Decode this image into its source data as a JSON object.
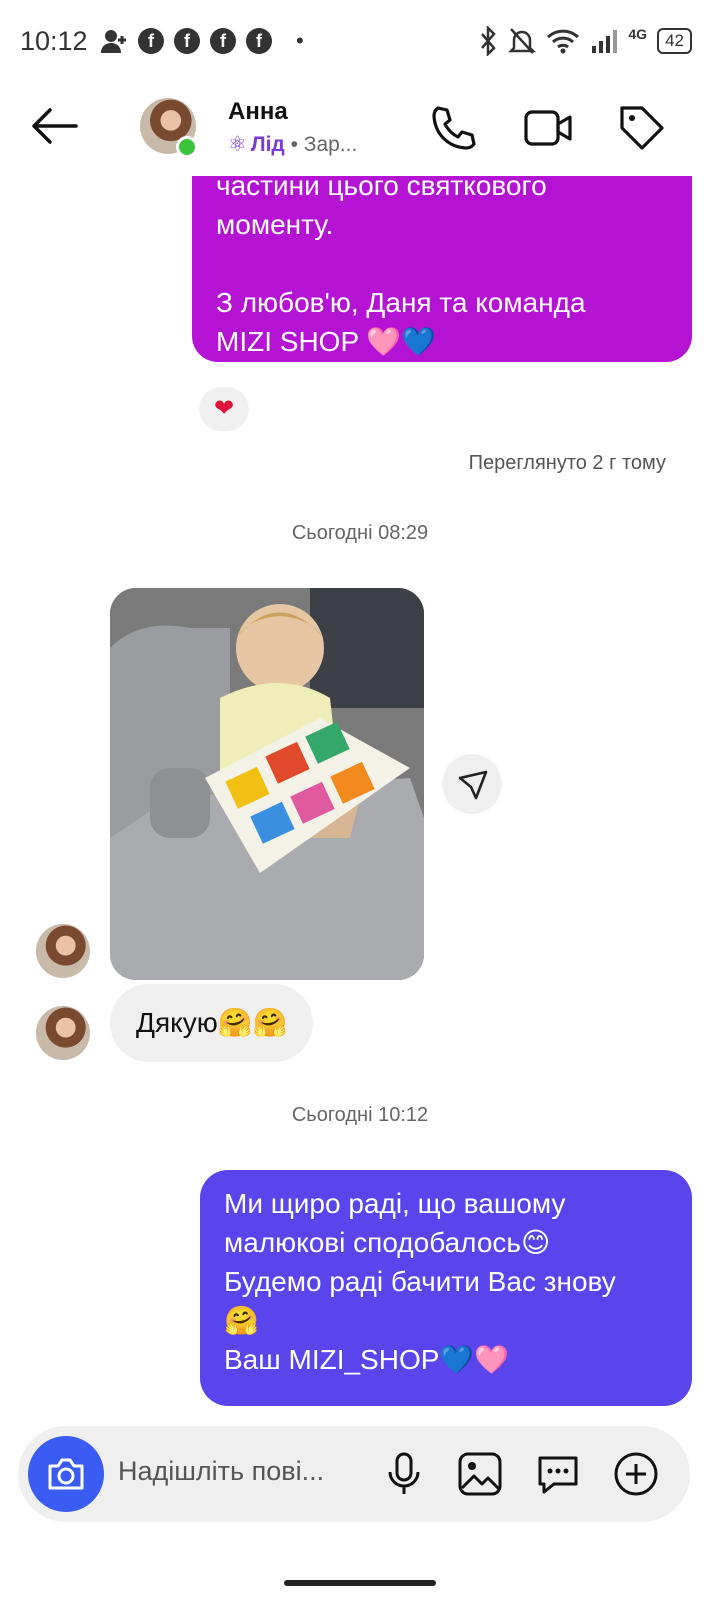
{
  "status_bar": {
    "time": "10:12",
    "network": "4G",
    "battery": "42"
  },
  "header": {
    "contact_name": "Анна",
    "lead_label": "Лід",
    "status_preview": "• Зар..."
  },
  "chat": {
    "messages": [
      {
        "type": "outgoing",
        "text": "частини цього святкового\nмоменту.\n\nЗ любов'ю, Даня та команда\nMIZI SHOP 🩷💙",
        "reaction": "❤"
      },
      {
        "type": "seen",
        "text": "Переглянуто 2 г тому"
      },
      {
        "type": "day_separator",
        "text": "Сьогодні 08:29"
      },
      {
        "type": "incoming_photo",
        "description": "child reading a book"
      },
      {
        "type": "incoming",
        "text": "Дякую🤗🤗"
      },
      {
        "type": "day_separator",
        "text": "Сьогодні 10:12"
      },
      {
        "type": "outgoing",
        "text": "Ми щиро раді, що вашому\nмалюкові сподобалось😊\nБудемо раді бачити Вас знову\n🤗\nВаш MIZI_SHOP💙🩷"
      }
    ]
  },
  "composer": {
    "placeholder": "Надішліть пові..."
  },
  "colors": {
    "outgoing_purple": "#b513d4",
    "outgoing_blue": "#5a44ec",
    "camera": "#3b5cf2",
    "online": "#3ac23a",
    "lead": "#7b3bd6"
  }
}
